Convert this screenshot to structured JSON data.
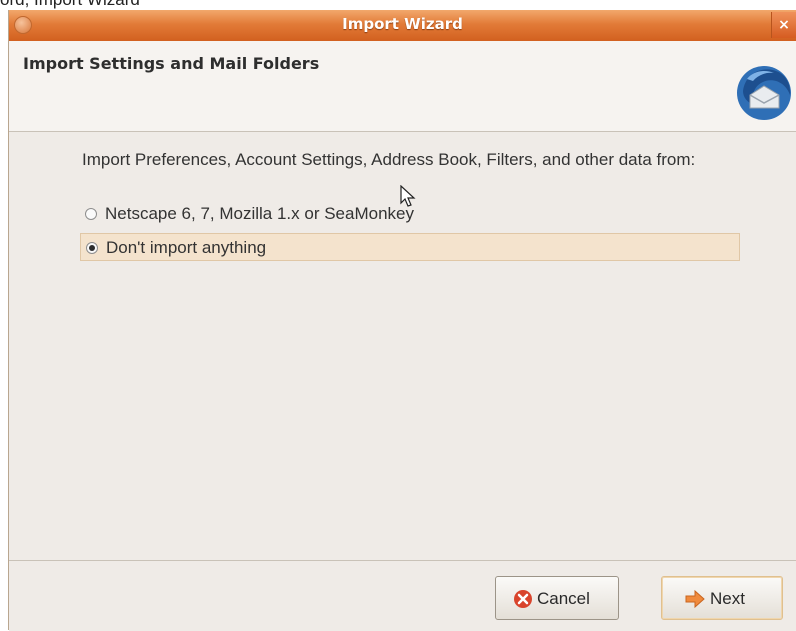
{
  "background_text": "ord, Import Wizard",
  "window": {
    "title": "Import Wizard",
    "close_glyph": "×"
  },
  "header": {
    "title": "Import Settings and Mail Folders",
    "logo_icon": "thunderbird-logo-icon"
  },
  "content": {
    "prompt": "Import Preferences, Account Settings, Address Book, Filters, and other data from:",
    "options": [
      {
        "label": "Netscape 6, 7, Mozilla 1.x or SeaMonkey",
        "selected": false
      },
      {
        "label": "Don't import anything",
        "selected": true
      }
    ]
  },
  "buttons": {
    "cancel_label": "Cancel",
    "next_label": "Next"
  },
  "colors": {
    "titlebar": "#e27b38",
    "selection": "#f4e3cd"
  }
}
